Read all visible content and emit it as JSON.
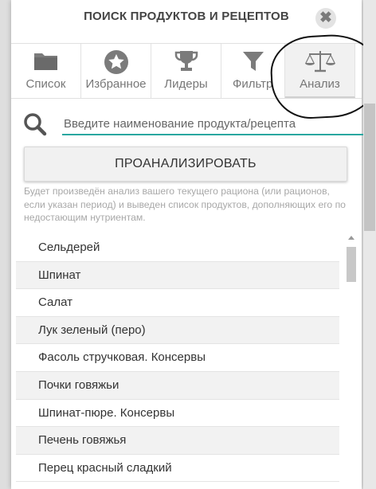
{
  "dialog": {
    "title": "ПОИСК ПРОДУКТОВ И РЕЦЕПТОВ",
    "close_glyph": "✖"
  },
  "tabs": [
    {
      "label": "Список",
      "icon": "folder-icon",
      "active": false
    },
    {
      "label": "Избранное",
      "icon": "star-icon",
      "active": false
    },
    {
      "label": "Лидеры",
      "icon": "trophy-icon",
      "active": false
    },
    {
      "label": "Фильтр",
      "icon": "filter-icon",
      "active": false
    },
    {
      "label": "Анализ",
      "icon": "scales-icon",
      "active": true
    }
  ],
  "search": {
    "placeholder": "Введите наименование продукта/рецепта",
    "value": ""
  },
  "analyze_button": "ПРОАНАЛИЗИРОВАТЬ",
  "hint": "Будет произведён анализ вашего текущего рациона (или рационов, если указан период) и выведен список продуктов, дополняющих его по недостающим нутриентам.",
  "products": [
    "Сельдерей",
    "Шпинат",
    "Салат",
    "Лук зеленый (перо)",
    "Фасоль стручковая. Консервы",
    "Почки говяжьи",
    "Шпинат-пюре. Консервы",
    "Печень говяжья",
    "Перец красный сладкий"
  ],
  "colors": {
    "accent_underline": "#2aa7a0",
    "icon_gray": "#7b7b7b",
    "hint_text": "#a8a8a8"
  }
}
